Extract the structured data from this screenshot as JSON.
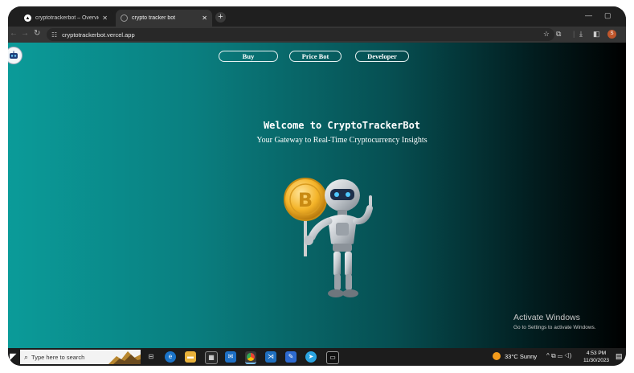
{
  "browser": {
    "tabs": [
      {
        "title": "cryptotrackerbot – Overview – V",
        "active": false
      },
      {
        "title": "crypto tracker bot",
        "active": true
      }
    ],
    "new_tab": "+",
    "url": "cryptotrackerbot.vercel.app",
    "window_controls": {
      "minimize": "—",
      "maximize": "▢"
    },
    "profile_initial": "S"
  },
  "page": {
    "nav": {
      "buy": "Buy",
      "price_bot": "Price Bot",
      "developer": "Developer"
    },
    "welcome": "Welcome to CryptoTrackerBot",
    "tagline": "Your Gateway to Real-Time Cryptocurrency Insights",
    "bitcoin_symbol": "B"
  },
  "watermark": {
    "line1": "Activate Windows",
    "line2": "Go to Settings to activate Windows."
  },
  "taskbar": {
    "search_placeholder": "Type here to search",
    "weather": "33°C  Sunny",
    "time": "4:53 PM",
    "date": "11/30/2023"
  },
  "colors": {
    "accent": "#0b9b99",
    "brand_dark": "#021d1f",
    "bitcoin": "#f4b429"
  }
}
